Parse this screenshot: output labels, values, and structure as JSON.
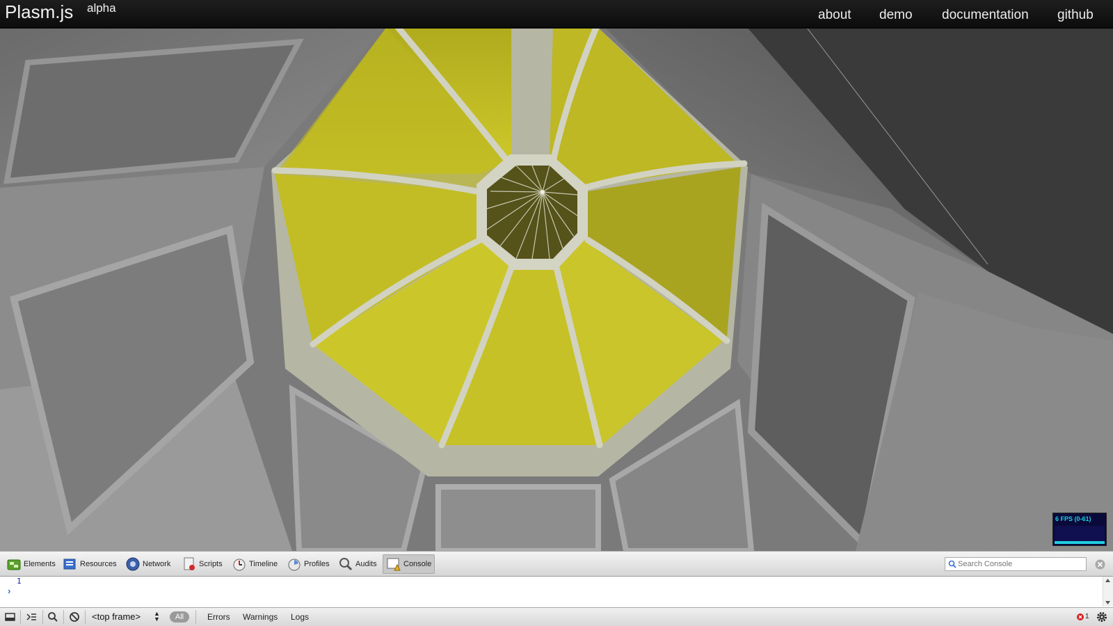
{
  "header": {
    "logo": "Plasm.js",
    "logo_sup": "alpha",
    "nav": [
      "about",
      "demo",
      "documentation",
      "github"
    ]
  },
  "scene": {
    "kind": "3d dome interior viewed from below",
    "colors": {
      "panel": "#c4c023",
      "rib": "#c8c8b8",
      "wall": "#7e7e7e",
      "shadow": "#3e3e3e"
    }
  },
  "fps_meter": {
    "label": "6 FPS (0-61)"
  },
  "devtools": {
    "tabs": [
      {
        "label": "Elements",
        "icon": "elements-icon"
      },
      {
        "label": "Resources",
        "icon": "resources-icon"
      },
      {
        "label": "Network",
        "icon": "network-icon"
      },
      {
        "label": "Scripts",
        "icon": "scripts-icon"
      },
      {
        "label": "Timeline",
        "icon": "timeline-icon"
      },
      {
        "label": "Profiles",
        "icon": "profiles-icon"
      },
      {
        "label": "Audits",
        "icon": "audits-icon"
      },
      {
        "label": "Console",
        "icon": "console-icon",
        "active": true
      }
    ],
    "search": {
      "placeholder": "Search Console",
      "value": ""
    },
    "console": {
      "line_number": "1",
      "prompt": "›"
    },
    "status": {
      "frame": "<top frame>",
      "filter_all": "All",
      "filters": [
        "Errors",
        "Warnings",
        "Logs"
      ],
      "error_count": "1"
    }
  }
}
